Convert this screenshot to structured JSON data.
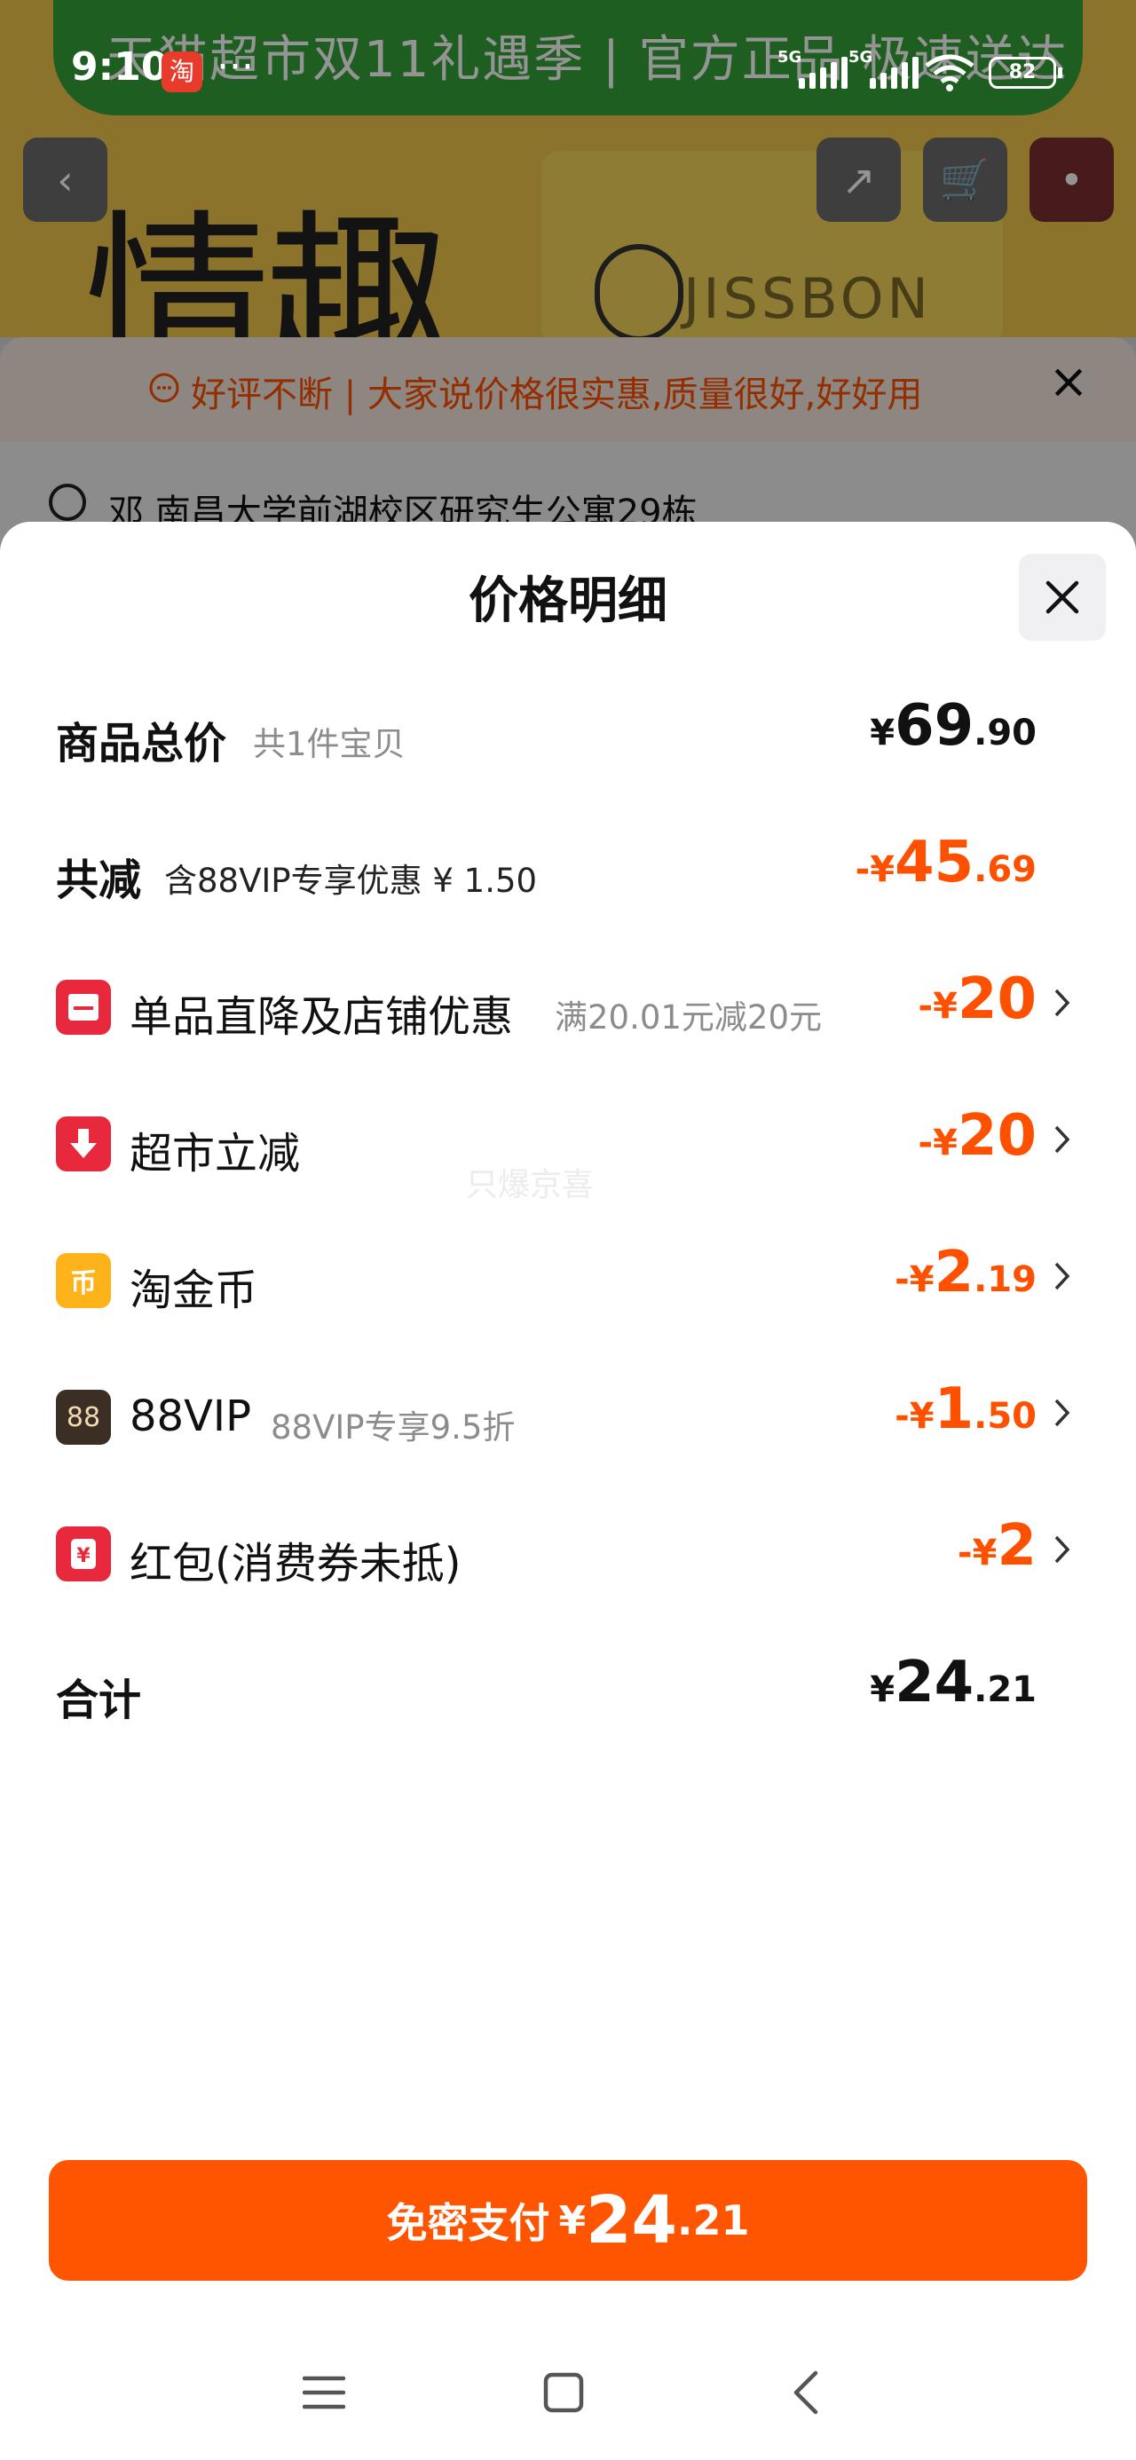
{
  "status_bar": {
    "time": "9:10",
    "app_icon": "淘",
    "dots": "···",
    "net1": "5G",
    "net2": "5G",
    "battery": "82"
  },
  "background": {
    "promo_text": "天猫超市双11礼遇季 | 官方正品 极速送达",
    "big_text": "情趣",
    "brand": "JISSBON",
    "notice": "好评不断 | 大家说价格很实惠,质量很好,好好用",
    "address": "邓 南昌大学前湖校区研究生公寓29栋"
  },
  "sheet": {
    "title": "价格明细",
    "rows": [
      {
        "label": "商品总价",
        "sub": "共1件宝贝",
        "cur": "¥",
        "int": "69",
        "dec": ".90",
        "icon": ""
      },
      {
        "label": "共减",
        "sub": "含88VIP专享优惠 ¥ 1.50",
        "cur": "-¥",
        "int": "45",
        "dec": ".69",
        "icon": ""
      },
      {
        "label": "单品直降及店铺优惠",
        "sub": "满20.01元减20元",
        "cur": "-¥",
        "int": "20",
        "dec": "",
        "icon": "store-icon"
      },
      {
        "label": "超市立减",
        "sub": "",
        "cur": "-¥",
        "int": "20",
        "dec": "",
        "icon": "down-arrow-icon"
      },
      {
        "label": "淘金币",
        "sub": "",
        "cur": "-¥",
        "int": "2",
        "dec": ".19",
        "icon": "coin-icon",
        "icon_glyph": "币"
      },
      {
        "label": "88VIP",
        "sub": "88VIP专享9.5折",
        "cur": "-¥",
        "int": "1",
        "dec": ".50",
        "icon": "vip-icon",
        "icon_glyph": "88"
      },
      {
        "label": "红包(消费券未抵)",
        "sub": "",
        "cur": "-¥",
        "int": "2",
        "dec": "",
        "icon": "red-packet-icon",
        "icon_glyph": "¥"
      },
      {
        "label": "合计",
        "sub": "",
        "cur": "¥",
        "int": "24",
        "dec": ".21",
        "icon": ""
      }
    ],
    "watermark": "只爆京喜",
    "pay_button": {
      "label": "免密支付",
      "cur": "¥",
      "int": "24",
      "dec": ".21"
    }
  },
  "colors": {
    "accent": "#ff5000",
    "pay": "#ff5500",
    "store_icon": "#e8283c",
    "coin_icon": "#ffb31a",
    "vip_icon": "#3b2e24"
  }
}
